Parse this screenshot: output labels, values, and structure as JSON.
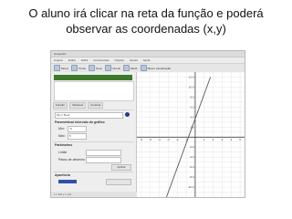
{
  "caption": {
    "line1": "O aluno irá clicar na reta da função e poderá",
    "line2": "observar as coordenadas (x,y)"
  },
  "window": {
    "title": "Geogebra",
    "menu": [
      "Arquivo",
      "Editar",
      "Exibir",
      "Ferramentas",
      "Opções",
      "Janela",
      "Ajuda"
    ],
    "toolbar": [
      {
        "label": "Mover",
        "icon": "move-icon"
      },
      {
        "label": "Ponto",
        "icon": "point-icon"
      },
      {
        "label": "Reta",
        "icon": "line-icon"
      },
      {
        "label": "Círculo",
        "icon": "circle-icon"
      },
      {
        "label": "Medir",
        "icon": "measure-icon"
      },
      {
        "label": "Mover visualização",
        "icon": "pan-icon"
      }
    ]
  },
  "left_panel": {
    "tabs": [
      "Função",
      "Variáveis",
      "Controle"
    ],
    "function_input": "f(x) = 5x+4",
    "section_interval": "Parametrizar intervalo do gráfico",
    "min_label": "Mín:",
    "min_value": "-5",
    "max_label": "Máx:",
    "max_value": "5",
    "section_params": "Parâmetros",
    "field1_label": "Limite",
    "field2_label": "Passo de desenho",
    "apply_button": "Aplicar",
    "section_appearance": "Aparência",
    "status": "x = 0.0  y = 4.0"
  },
  "chart_data": {
    "type": "line",
    "x_ticks": [
      "-6",
      "-5",
      "-4",
      "-3",
      "-2",
      "-1",
      "1",
      "2",
      "3",
      "4",
      "5"
    ],
    "y_ticks": [
      "12.0",
      "10.0",
      "8.0",
      "6.0",
      "4.0",
      "2.0",
      "-2.0",
      "-4.0",
      "-6.0",
      "-8.0",
      "-10.0"
    ],
    "series": [
      {
        "x": [
          -3.2,
          1.7
        ],
        "y": [
          -12,
          12
        ]
      }
    ],
    "xlim": [
      -6.5,
      5.5
    ],
    "ylim": [
      -12,
      13
    ],
    "grid": true,
    "colors": {
      "line": "#555566",
      "grid": "#e6e6e6",
      "axis": "#222222"
    }
  }
}
